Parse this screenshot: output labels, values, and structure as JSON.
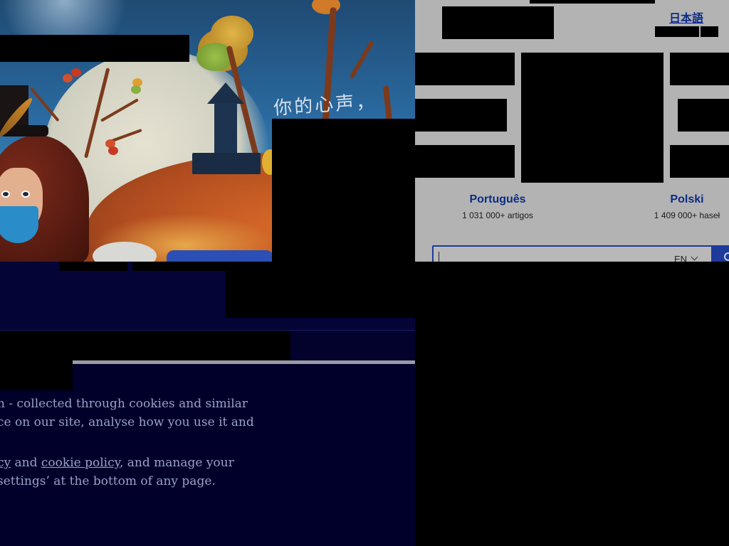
{
  "left_window": {
    "illustration_caption": "你的心声，",
    "consent": {
      "paragraph_1": {
        "line_1": "n - collected through cookies and similar",
        "line_2": "ce on our site, analyse how you use it and"
      },
      "paragraph_2": {
        "prefix": "cy",
        "and_text": " and ",
        "cookie_policy_link": "cookie policy",
        "suffix": ", and manage your",
        "line_2": "settings’ at the bottom of any page."
      }
    }
  },
  "right_window": {
    "languages": [
      {
        "name": "日本語",
        "count": ""
      },
      {
        "name": "Português",
        "count": "1 031 000+ artigos"
      },
      {
        "name": "Polski",
        "count": "1 409 000+ haseł"
      }
    ],
    "search": {
      "language_selector": "EN",
      "placeholder": ""
    }
  },
  "colors": {
    "link_blue": "#0b2c84",
    "dimmed_portal_bg": "#b3b3b3",
    "overlay_navy": "#00002a",
    "consent_text": "#9aa0c8"
  }
}
